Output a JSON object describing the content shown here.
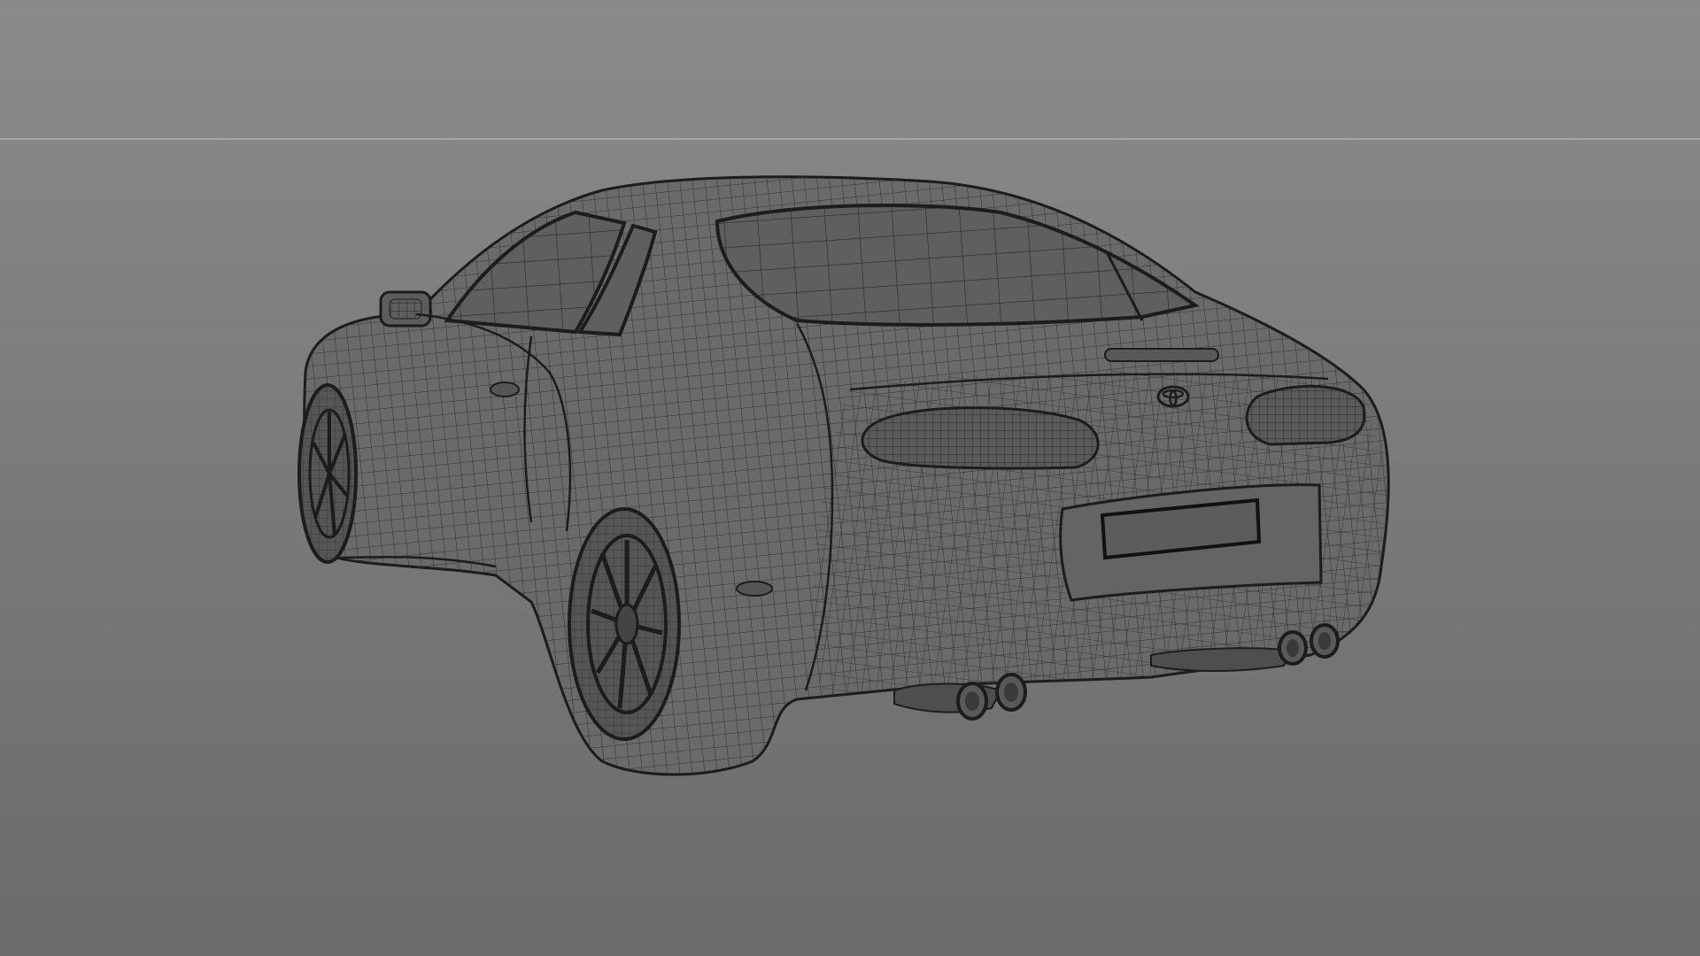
{
  "scene": {
    "model": "sports-coupe-wireframe",
    "emblem_icon": "toyota-logo-icon",
    "colors": {
      "background_top": "#8a8a8a",
      "background_bottom": "#6b6b6b",
      "horizon": "#a6a6a6",
      "surface": "#6a6a6a",
      "glass": "#5f5f5f",
      "wire": "#2a2a2a",
      "outline": "#1c1c1c"
    }
  }
}
